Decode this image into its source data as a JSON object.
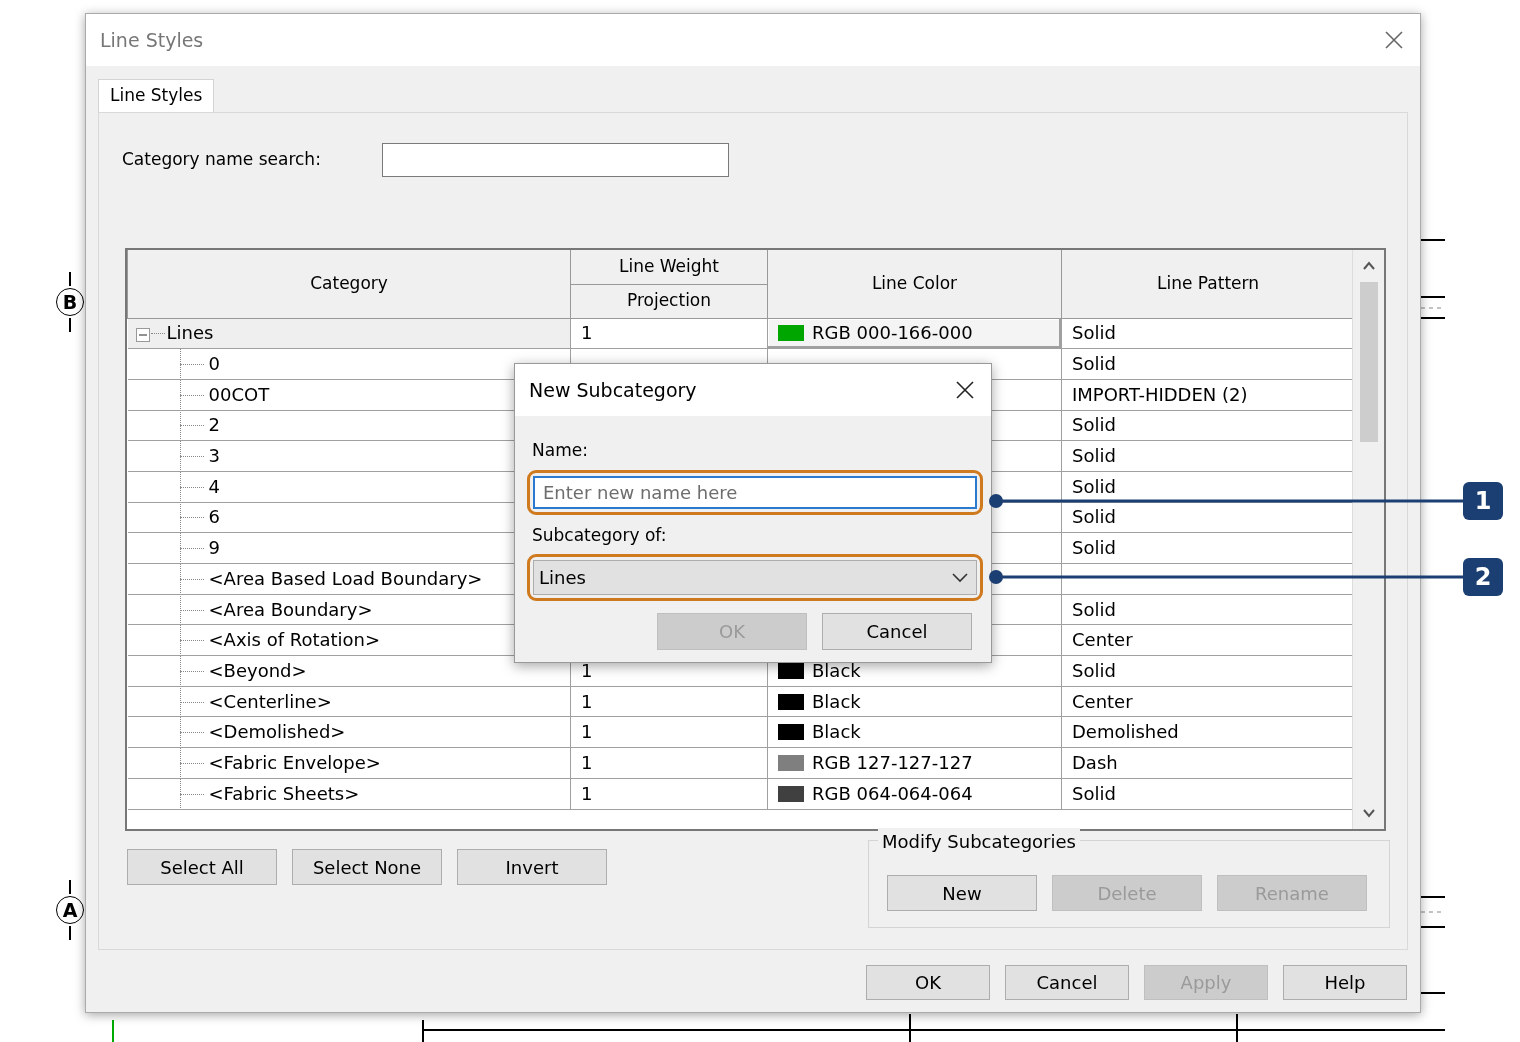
{
  "background": {
    "grid_markers": [
      "B",
      "A"
    ]
  },
  "window": {
    "title": "Line Styles"
  },
  "tabs": [
    {
      "label": "Line Styles",
      "selected": true
    }
  ],
  "search": {
    "label": "Category name search:"
  },
  "table": {
    "columns": [
      {
        "label": "Category"
      },
      {
        "label": "Line Weight",
        "sub_label": "Projection"
      },
      {
        "label": "Line Color"
      },
      {
        "label": "Line Pattern"
      }
    ],
    "rows": [
      {
        "category": "Lines",
        "selected": true,
        "expanded": true,
        "weight": "1",
        "color_label": "RGB 000-166-000",
        "color": "#00a600",
        "pattern": "Solid",
        "children": [
          {
            "category": "0",
            "selected": false,
            "pattern": "Solid"
          },
          {
            "category": "00COT",
            "selected": false,
            "pattern": "IMPORT-HIDDEN (2)"
          },
          {
            "category": "2",
            "selected": false,
            "pattern": "Solid"
          },
          {
            "category": "3",
            "selected": false,
            "pattern": "Solid"
          },
          {
            "category": "4",
            "selected": false,
            "pattern": "Solid"
          },
          {
            "category": "6",
            "selected": false,
            "pattern": "Solid"
          },
          {
            "category": "9",
            "selected": false,
            "pattern": "Solid"
          },
          {
            "category": "<Area Based Load Boundary>",
            "selected": false
          },
          {
            "category": "<Area Boundary>",
            "selected": false,
            "pattern": "Solid"
          },
          {
            "category": "<Axis of Rotation>",
            "selected": false,
            "pattern": "Center"
          },
          {
            "category": "<Beyond>",
            "selected": false,
            "weight": "1",
            "color_label": "Black",
            "color": "#000000",
            "pattern": "Solid"
          },
          {
            "category": "<Centerline>",
            "selected": false,
            "weight": "1",
            "color_label": "Black",
            "color": "#000000",
            "pattern": "Center"
          },
          {
            "category": "<Demolished>",
            "selected": false,
            "weight": "1",
            "color_label": "Black",
            "color": "#000000",
            "pattern": "Demolished"
          },
          {
            "category": "<Fabric Envelope>",
            "selected": false,
            "weight": "1",
            "color_label": "RGB 127-127-127",
            "color": "#7f7f7f",
            "pattern": "Dash"
          },
          {
            "category": "<Fabric Sheets>",
            "selected": false,
            "weight": "1",
            "color_label": "RGB 064-064-064",
            "color": "#404040",
            "pattern": "Solid"
          }
        ]
      }
    ]
  },
  "selection_buttons": [
    {
      "label": "Select All",
      "disabled": false
    },
    {
      "label": "Select None",
      "disabled": false
    },
    {
      "label": "Invert",
      "disabled": false
    }
  ],
  "modify_group": {
    "title": "Modify Subcategories",
    "buttons": [
      {
        "label": "New",
        "disabled": false
      },
      {
        "label": "Delete",
        "disabled": true
      },
      {
        "label": "Rename",
        "disabled": true
      }
    ]
  },
  "footer_buttons": [
    {
      "label": "OK",
      "disabled": false
    },
    {
      "label": "Cancel",
      "disabled": false
    },
    {
      "label": "Apply",
      "disabled": true
    },
    {
      "label": "Help",
      "disabled": false
    }
  ],
  "dialog": {
    "title": "New Subcategory",
    "name_label": "Name:",
    "name_placeholder": "Enter new name here",
    "parent_label": "Subcategory of:",
    "parent_value": "Lines",
    "buttons": [
      {
        "label": "OK",
        "disabled": true
      },
      {
        "label": "Cancel",
        "disabled": false
      }
    ]
  },
  "callouts": [
    {
      "number": "1"
    },
    {
      "number": "2"
    }
  ]
}
